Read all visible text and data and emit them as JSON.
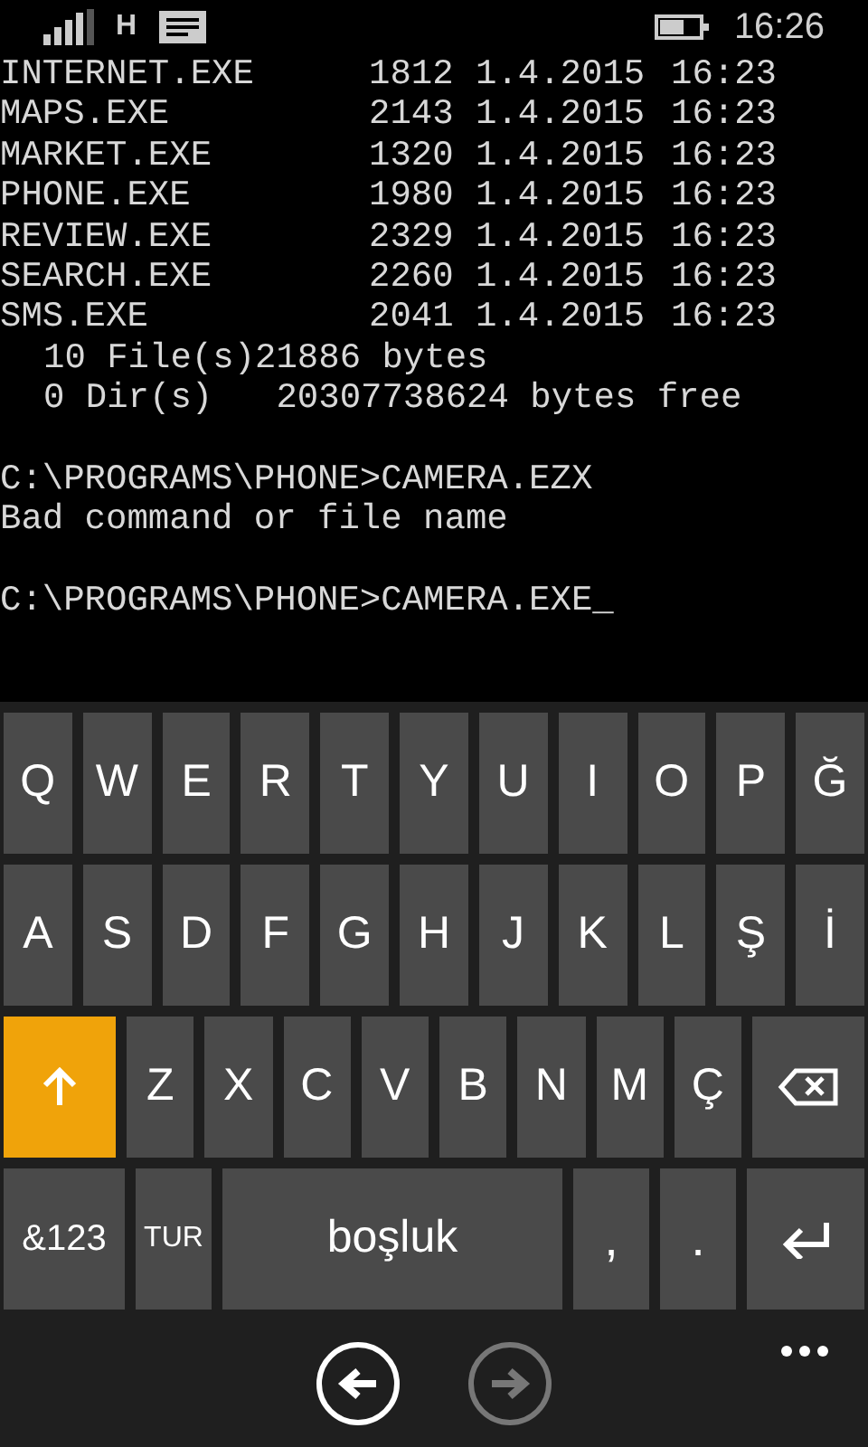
{
  "status_bar": {
    "network": "H",
    "time": "16:26"
  },
  "terminal": {
    "files": [
      {
        "name": "INTERNET.EXE",
        "size": "1812",
        "date": "1.4.2015",
        "time": "16:23"
      },
      {
        "name": "MAPS.EXE",
        "size": "2143",
        "date": "1.4.2015",
        "time": "16:23"
      },
      {
        "name": "MARKET.EXE",
        "size": "1320",
        "date": "1.4.2015",
        "time": "16:23"
      },
      {
        "name": "PHONE.EXE",
        "size": "1980",
        "date": "1.4.2015",
        "time": "16:23"
      },
      {
        "name": "REVIEW.EXE",
        "size": "2329",
        "date": "1.4.2015",
        "time": "16:23"
      },
      {
        "name": "SEARCH.EXE",
        "size": "2260",
        "date": "1.4.2015",
        "time": "16:23"
      },
      {
        "name": "SMS.EXE",
        "size": "2041",
        "date": "1.4.2015",
        "time": "16:23"
      }
    ],
    "summary": [
      "10 File(s)21886 bytes",
      "0 Dir(s)   20307738624 bytes free"
    ],
    "sessions": [
      {
        "command": "C:\\PROGRAMS\\PHONE>CAMERA.EZX",
        "output": "Bad command or file name"
      },
      {
        "command": "C:\\PROGRAMS\\PHONE>CAMERA.EXE_"
      }
    ]
  },
  "keyboard": {
    "rows": [
      {
        "keys": [
          {
            "kind": "letter",
            "label": "Q"
          },
          {
            "kind": "letter",
            "label": "W"
          },
          {
            "kind": "letter",
            "label": "E"
          },
          {
            "kind": "letter",
            "label": "R"
          },
          {
            "kind": "letter",
            "label": "T"
          },
          {
            "kind": "letter",
            "label": "Y"
          },
          {
            "kind": "letter",
            "label": "U"
          },
          {
            "kind": "letter",
            "label": "I"
          },
          {
            "kind": "letter",
            "label": "O"
          },
          {
            "kind": "letter",
            "label": "P"
          },
          {
            "kind": "letter",
            "label": "Ğ"
          }
        ]
      },
      {
        "keys": [
          {
            "kind": "letter",
            "label": "A"
          },
          {
            "kind": "letter",
            "label": "S"
          },
          {
            "kind": "letter",
            "label": "D"
          },
          {
            "kind": "letter",
            "label": "F"
          },
          {
            "kind": "letter",
            "label": "G"
          },
          {
            "kind": "letter",
            "label": "H"
          },
          {
            "kind": "letter",
            "label": "J"
          },
          {
            "kind": "letter",
            "label": "K"
          },
          {
            "kind": "letter",
            "label": "L"
          },
          {
            "kind": "letter",
            "label": "Ş"
          },
          {
            "kind": "letter",
            "label": "İ"
          }
        ]
      },
      {
        "keys": [
          {
            "kind": "shift",
            "on": true
          },
          {
            "kind": "letter",
            "label": "Z"
          },
          {
            "kind": "letter",
            "label": "X"
          },
          {
            "kind": "letter",
            "label": "C"
          },
          {
            "kind": "letter",
            "label": "V"
          },
          {
            "kind": "letter",
            "label": "B"
          },
          {
            "kind": "letter",
            "label": "N"
          },
          {
            "kind": "letter",
            "label": "M"
          },
          {
            "kind": "letter",
            "label": "Ç"
          },
          {
            "kind": "backspace"
          }
        ]
      },
      {
        "keys": [
          {
            "kind": "symbols",
            "label": "&123"
          },
          {
            "kind": "language",
            "label": "TUR"
          },
          {
            "kind": "space",
            "label": "boşluk"
          },
          {
            "kind": "punct",
            "label": ","
          },
          {
            "kind": "punct",
            "label": "."
          },
          {
            "kind": "enter"
          }
        ]
      }
    ]
  },
  "nav": {
    "back": {
      "disabled": false
    },
    "forward": {
      "disabled": true
    }
  }
}
